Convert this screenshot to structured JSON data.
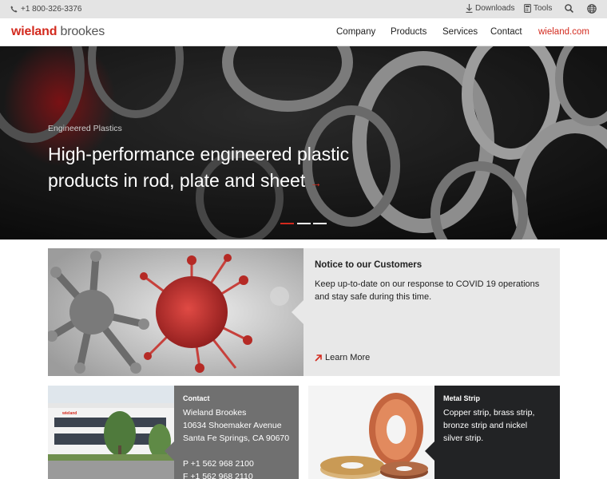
{
  "topbar": {
    "phone": "+1 800-326-3376",
    "downloads": "Downloads",
    "tools": "Tools",
    "search_icon": "search-icon",
    "language_icon": "globe-icon"
  },
  "nav": {
    "logo_primary": "wieland",
    "logo_secondary": "brookes",
    "items": [
      "Company",
      "Products",
      "Services",
      "Contact"
    ],
    "external": "wieland.com"
  },
  "hero": {
    "eyebrow": "Engineered Plastics",
    "headline": "High-performance engineered plastic products in rod, plate and sheet",
    "slides": 3,
    "active_slide": 1
  },
  "notice": {
    "title": "Notice to our Customers",
    "body": "Keep up-to-date on our response to COVID 19 operations and stay safe during this time.",
    "link": "Learn More"
  },
  "contact_card": {
    "title": "Contact",
    "lines": [
      "Wieland Brookes",
      "10634 Shoemaker Avenue",
      "Santa Fe Springs, CA 90670",
      "",
      "P +1 562 968 2100",
      "F +1 562 968 2110"
    ]
  },
  "metal_card": {
    "title": "Metal Strip",
    "lines": [
      "Copper strip, brass strip,",
      "bronze strip and nickel",
      "silver strip."
    ]
  },
  "colors": {
    "brand_red": "#d32a1e",
    "topbar_bg": "#e4e4e4",
    "notice_bg": "#e8e8e8",
    "contact_panel": "#707070",
    "metal_panel": "#222325"
  }
}
